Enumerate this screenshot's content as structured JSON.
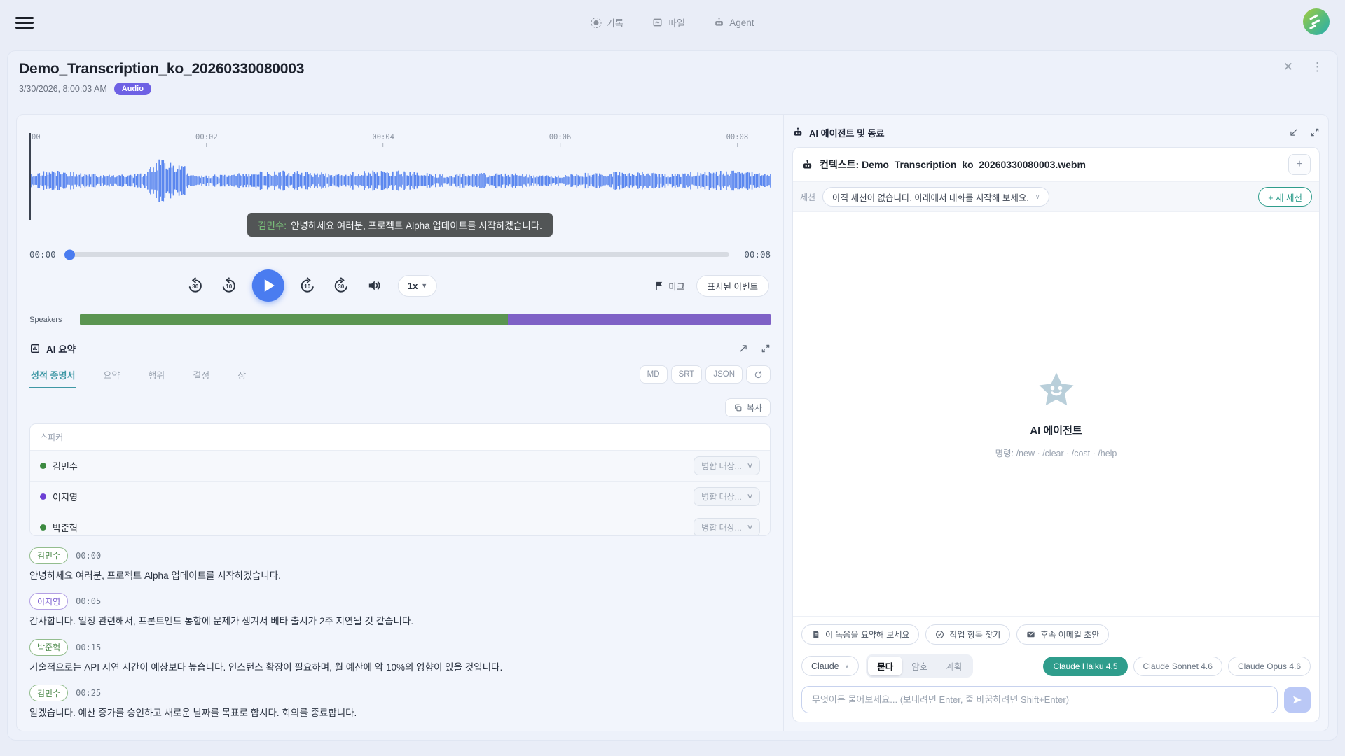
{
  "colors": {
    "accent_blue": "#4a7cf0",
    "wave_blue": "#5b87ef",
    "badge_purple": "#6e61e4",
    "teal": "#2f9d8c",
    "tab_teal": "#3f98a5",
    "speaker_green": "#5b9551",
    "speaker_purple": "#7f61c6"
  },
  "topbar": {
    "tabs": [
      {
        "label": "기록"
      },
      {
        "label": "파일"
      },
      {
        "label": "Agent"
      }
    ]
  },
  "header": {
    "title": "Demo_Transcription_ko_20260330080003",
    "datetime": "3/30/2026, 8:00:03 AM",
    "badge": "Audio"
  },
  "player": {
    "ruler_ticks": [
      "00",
      "00:02",
      "00:04",
      "00:06",
      "00:08"
    ],
    "subtitle": {
      "speaker": "김민수:",
      "text": "안녕하세요 여러분, 프로젝트 Alpha 업데이트를 시작하겠습니다."
    },
    "current_time": "00:00",
    "remaining_time": "-00:08",
    "speed": "1x",
    "mark_label": "마크",
    "events_label": "표시된 이벤트",
    "speakers_label": "Speakers",
    "speaker_segments": [
      {
        "color": "#5b9551",
        "width": 62
      },
      {
        "color": "#7f61c6",
        "width": 38
      }
    ]
  },
  "summary": {
    "title": "AI 요약",
    "tabs": [
      "성적 증명서",
      "요약",
      "행위",
      "결정",
      "장"
    ],
    "export_buttons": [
      "MD",
      "SRT",
      "JSON"
    ],
    "copy_label": "복사",
    "speaker_box_title": "스피커",
    "speakers": [
      {
        "name": "김민수",
        "merge_label": "병합 대상..."
      },
      {
        "name": "이지영",
        "merge_label": "병합 대상..."
      },
      {
        "name": "박준혁",
        "merge_label": "병합 대상..."
      }
    ],
    "transcript": [
      {
        "speaker": "김민수",
        "time": "00:00",
        "text": "안녕하세요 여러분, 프로젝트 Alpha 업데이트를 시작하겠습니다."
      },
      {
        "speaker": "이지영",
        "time": "00:05",
        "text": "감사합니다. 일정 관련해서, 프론트엔드 통합에 문제가 생겨서 베타 출시가 2주 지연될 것 같습니다."
      },
      {
        "speaker": "박준혁",
        "time": "00:15",
        "text": "기술적으로는 API 지연 시간이 예상보다 높습니다. 인스턴스 확장이 필요하며, 월 예산에 약 10%의 영향이 있을 것입니다."
      },
      {
        "speaker": "김민수",
        "time": "00:25",
        "text": "알겠습니다. 예산 증가를 승인하고 새로운 날짜를 목표로 합시다. 회의를 종료합니다."
      }
    ]
  },
  "agent_panel": {
    "title": "AI 에이전트 및 동료",
    "context_label": "컨텍스트: Demo_Transcription_ko_20260330080003.webm",
    "add_label": "+",
    "session_label": "세션",
    "session_value": "아직 세션이 없습니다. 아래에서 대화를 시작해 보세요.",
    "new_session_label": "+ 새 세션",
    "empty_title": "AI 에이전트",
    "empty_commands": "명령: /new · /clear · /cost · /help",
    "suggestions": [
      "이 녹음을 요약해 보세요",
      "작업 항목 찾기",
      "후속 이메일 초안"
    ],
    "provider": "Claude",
    "modes": [
      "묻다",
      "암호",
      "계획"
    ],
    "models": [
      "Claude Haiku 4.5",
      "Claude Sonnet 4.6",
      "Claude Opus 4.6"
    ],
    "input_placeholder": "무엇이든 물어보세요... (보내려면 Enter, 줄 바꿈하려면 Shift+Enter)"
  }
}
